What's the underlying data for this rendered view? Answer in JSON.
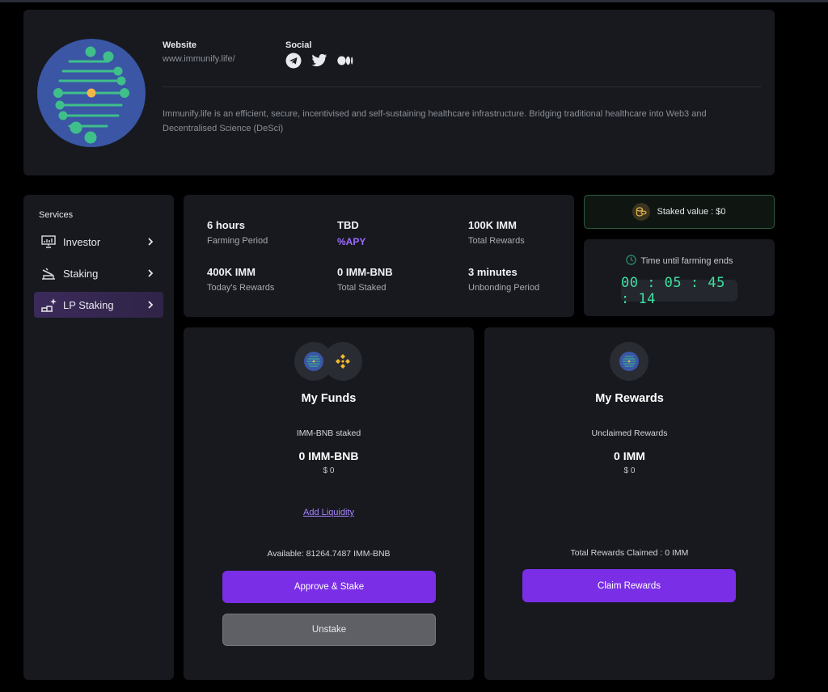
{
  "project": {
    "website_label": "Website",
    "website_url": "www.immunify.life/",
    "social_label": "Social",
    "social_icons": [
      "telegram-icon",
      "twitter-icon",
      "medium-icon"
    ],
    "description": "Immunify.life is an efficient, secure, incentivised and self-sustaining healthcare infrastructure. Bridging traditional healthcare into Web3 and Decentralised Science (DeSci)"
  },
  "sidebar": {
    "title": "Services",
    "items": [
      {
        "label": "Investor",
        "icon": "presentation-chart-icon"
      },
      {
        "label": "Staking",
        "icon": "staking-icon"
      },
      {
        "label": "LP Staking",
        "icon": "lp-staking-icon",
        "active": true
      }
    ]
  },
  "stats": [
    {
      "value": "6 hours",
      "label": "Farming Period"
    },
    {
      "value": "TBD",
      "label": "%APY"
    },
    {
      "value": "100K IMM",
      "label": "Total Rewards"
    },
    {
      "value": "400K IMM",
      "label": "Today's Rewards"
    },
    {
      "value": "0 IMM-BNB",
      "label": "Total Staked"
    },
    {
      "value": "3 minutes",
      "label": "Unbonding Period"
    }
  ],
  "staked": {
    "text": "Staked value : $0"
  },
  "timer": {
    "title": "Time until farming ends",
    "value": "00 : 05 : 45 : 14"
  },
  "funds": {
    "title": "My Funds",
    "staked_label": "IMM-BNB staked",
    "amount": "0 IMM-BNB",
    "usd": "$ 0",
    "add_liquidity": "Add Liquidity",
    "available": "Available: 81264.7487 IMM-BNB",
    "approve_button": "Approve & Stake",
    "unstake_button": "Unstake"
  },
  "rewards": {
    "title": "My Rewards",
    "unclaimed_label": "Unclaimed Rewards",
    "amount": "0 IMM",
    "usd": "$ 0",
    "total_claimed": "Total Rewards Claimed : 0 IMM",
    "claim_button": "Claim Rewards"
  },
  "colors": {
    "accent": "#7a2ee6",
    "timer": "#3ee0a0",
    "apy": "#9e6bff",
    "card": "#17191f",
    "logo_blue": "#3a56a5",
    "logo_green": "#3fbf8a"
  }
}
